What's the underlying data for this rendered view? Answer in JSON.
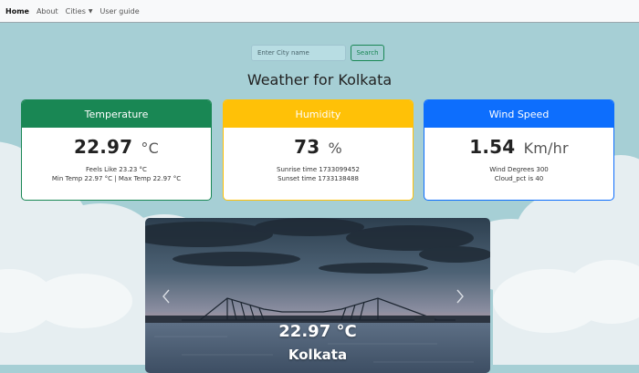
{
  "nav": {
    "items": [
      {
        "label": "Home",
        "active": true
      },
      {
        "label": "About",
        "active": false
      },
      {
        "label": "Cities",
        "active": false,
        "dropdown": true
      },
      {
        "label": "User guide",
        "active": false
      }
    ]
  },
  "search": {
    "placeholder": "Enter City name",
    "button_label": "Search"
  },
  "title": "Weather for Kolkata",
  "cards": {
    "temperature": {
      "header": "Temperature",
      "value": "22.97",
      "unit": "°C",
      "line1": "Feels Like 23.23 °C",
      "line2": "Min Temp 22.97 °C | Max Temp 22.97 °C",
      "color": "#198754"
    },
    "humidity": {
      "header": "Humidity",
      "value": "73",
      "unit": "%",
      "line1": "Sunrise time 1733099452",
      "line2": "Sunset time 1733138488",
      "color": "#ffc107"
    },
    "wind": {
      "header": "Wind Speed",
      "value": "1.54",
      "unit": "Km/hr",
      "line1": "Wind Degrees 300",
      "line2": "Cloud_pct is 40",
      "color": "#0d6efd"
    }
  },
  "carousel": {
    "temp": "22.97 °C",
    "city": "Kolkata"
  }
}
